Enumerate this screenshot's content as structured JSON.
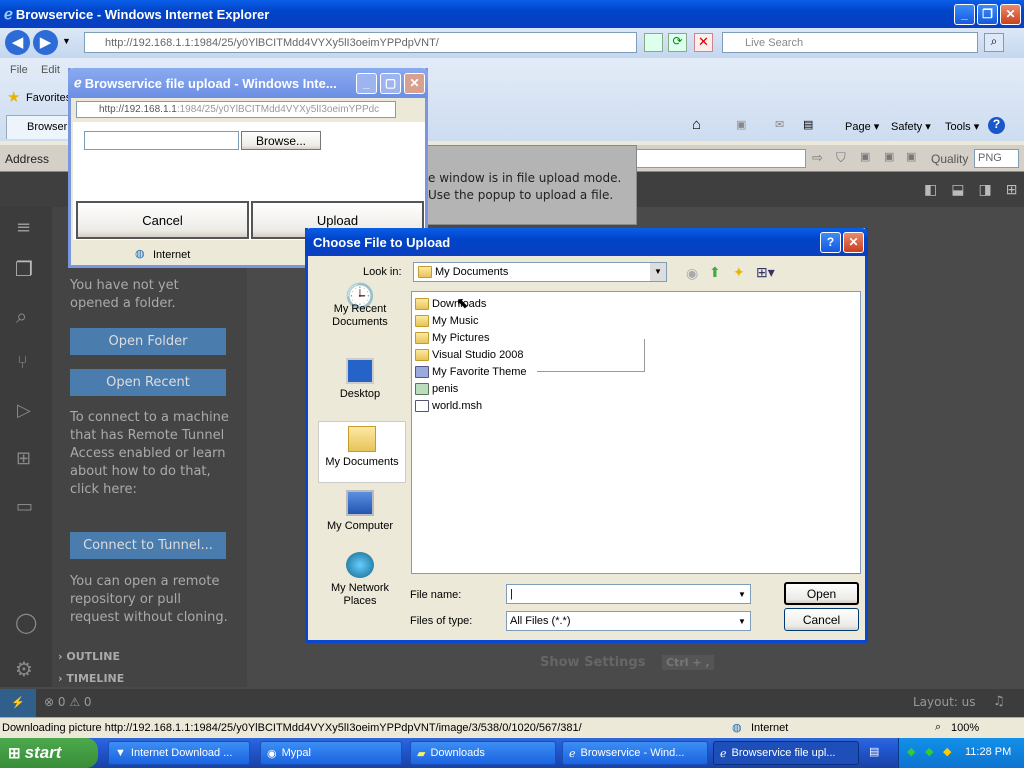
{
  "ie": {
    "title": "Browservice - Windows Internet Explorer",
    "url": "http://192.168.1.1:1984/25/y0YlBCITMdd4VYXy5lI3oeimYPPdpVNT/",
    "search_placeholder": "Live Search",
    "menu": [
      "File",
      "Edit"
    ],
    "favorites_label": "Favorites",
    "tab_label": "Browser",
    "toolbar": {
      "page": "Page ▾",
      "safety": "Safety ▾",
      "tools": "Tools ▾"
    },
    "status_text": "Downloading picture http://192.168.1.1:1984/25/y0YlBCITMdd4VYXy5lI3oeimYPPdpVNT/image/3/538/0/1020/567/381/M(",
    "status_zone": "Internet",
    "zoom": "100%"
  },
  "browservice": {
    "address_label": "Address",
    "quality_label": "Quality",
    "quality_value": "PNG",
    "notice_line1": "e window is in file upload mode.",
    "notice_line2": "Use the popup to upload a file."
  },
  "vscode": {
    "no_folder_text": "You have not yet opened a folder.",
    "open_folder": "Open Folder",
    "open_recent": "Open Recent",
    "tunnel_text": "To connect to a machine that has Remote Tunnel Access enabled or learn about how to do that, click here:",
    "connect_tunnel": "Connect to Tunnel...",
    "remote_text": "You can open a remote repository or pull request without cloning.",
    "outline": "OUTLINE",
    "timeline": "TIMELINE",
    "show_settings": "Show Settings",
    "shortcut": "Ctrl + ,",
    "errors": "0",
    "warnings": "0",
    "layout": "Layout: us"
  },
  "upload_popup": {
    "title": "Browservice file upload - Windows Inte...",
    "url_host": "http://192.168.1.1",
    "url_rest": ":1984/25/y0YlBCITMdd4VYXy5lI3oeimYPPdc",
    "browse": "Browse...",
    "cancel": "Cancel",
    "upload": "Upload",
    "status_zone": "Internet"
  },
  "file_dialog": {
    "title": "Choose File to Upload",
    "look_in_label": "Look in:",
    "look_in_value": "My Documents",
    "places": [
      "My Recent Documents",
      "Desktop",
      "My Documents",
      "My Computer",
      "My Network Places"
    ],
    "files": [
      {
        "name": "Downloads",
        "type": "folder"
      },
      {
        "name": "My Music",
        "type": "folder"
      },
      {
        "name": "My Pictures",
        "type": "folder"
      },
      {
        "name": "Visual Studio 2008",
        "type": "folder"
      },
      {
        "name": "My Favorite Theme",
        "type": "theme"
      },
      {
        "name": "penis",
        "type": "image"
      },
      {
        "name": "world.msh",
        "type": "file"
      }
    ],
    "file_name_label": "File name:",
    "file_name_value": "",
    "files_of_type_label": "Files of type:",
    "files_of_type_value": "All Files (*.*)",
    "open": "Open",
    "cancel": "Cancel"
  },
  "taskbar": {
    "start": "start",
    "buttons": [
      "Internet Download ...",
      "Mypal",
      "Downloads",
      "Browservice - Wind...",
      "Browservice file upl..."
    ],
    "clock": "11:28 PM"
  }
}
